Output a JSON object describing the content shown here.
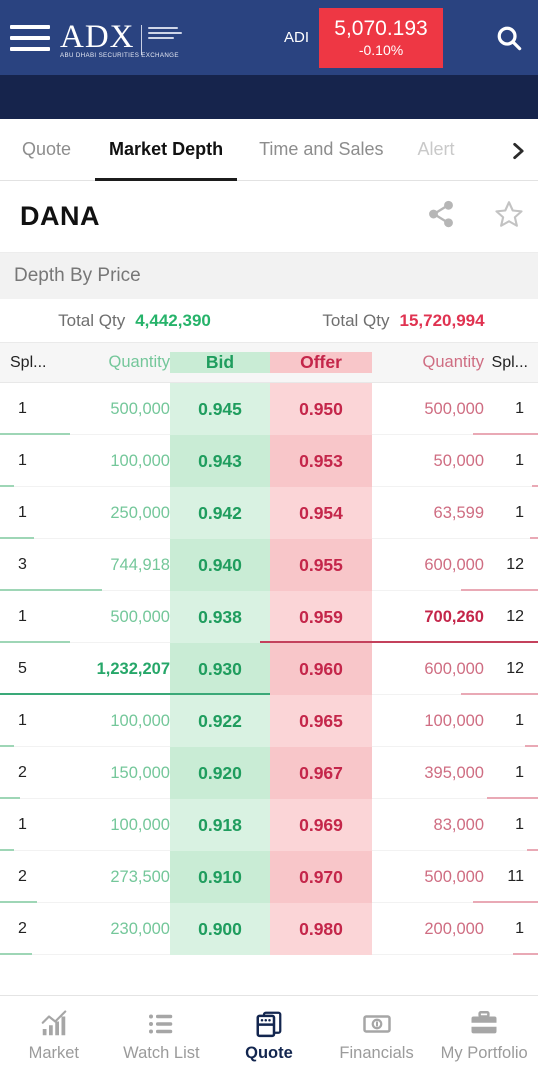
{
  "header": {
    "menu_icon": "hamburger-icon",
    "brand_title": "ADX",
    "brand_subtitle": "ABU DHABI SECURITIES EXCHANGE",
    "index_name": "ADI",
    "index_value": "5,070.193",
    "index_change": "-0.10%",
    "index_color": "#ee3744",
    "search_icon": "search-icon",
    "bg_color": "#2a4380",
    "band_color": "#16244c"
  },
  "tabs": [
    {
      "label": "Quote",
      "active": false
    },
    {
      "label": "Market Depth",
      "active": true
    },
    {
      "label": "Time and Sales",
      "active": false
    },
    {
      "label": "Alert",
      "active": false
    }
  ],
  "tabs_more_icon": "chevron-right-icon",
  "symbol": {
    "name": "DANA",
    "share_icon": "share-icon",
    "favorite_icon": "star-icon"
  },
  "depth": {
    "section_title": "Depth By Price",
    "total_label_bid": "Total Qty",
    "total_value_bid": "4,442,390",
    "total_label_ask": "Total Qty",
    "total_value_ask": "15,720,994",
    "bid_color": "#26b36a",
    "ask_color": "#e03351",
    "columns": [
      "Spl...",
      "Quantity",
      "Bid",
      "Offer",
      "Quantity",
      "Spl..."
    ],
    "rows": [
      {
        "spl_l": "1",
        "qty_l": "500,000",
        "bid": "0.945",
        "ask": "0.950",
        "qty_r": "500,000",
        "spl_r": "1",
        "bar_l": 41,
        "bar_r": 41,
        "hl_l": false,
        "hl_r": false
      },
      {
        "spl_l": "1",
        "qty_l": "100,000",
        "bid": "0.943",
        "ask": "0.953",
        "qty_r": "50,000",
        "spl_r": "1",
        "bar_l": 8,
        "bar_r": 4,
        "hl_l": false,
        "hl_r": false
      },
      {
        "spl_l": "1",
        "qty_l": "250,000",
        "bid": "0.942",
        "ask": "0.954",
        "qty_r": "63,599",
        "spl_r": "1",
        "bar_l": 20,
        "bar_r": 5,
        "hl_l": false,
        "hl_r": false
      },
      {
        "spl_l": "3",
        "qty_l": "744,918",
        "bid": "0.940",
        "ask": "0.955",
        "qty_r": "600,000",
        "spl_r": "12",
        "bar_l": 60,
        "bar_r": 49,
        "hl_l": false,
        "hl_r": false
      },
      {
        "spl_l": "1",
        "qty_l": "500,000",
        "bid": "0.938",
        "ask": "0.959",
        "qty_r": "700,260",
        "spl_r": "12",
        "bar_l": 41,
        "bar_r": 100,
        "hl_l": false,
        "hl_r": true
      },
      {
        "spl_l": "5",
        "qty_l": "1,232,207",
        "bid": "0.930",
        "ask": "0.960",
        "qty_r": "600,000",
        "spl_r": "12",
        "bar_l": 100,
        "bar_r": 49,
        "hl_l": true,
        "hl_r": false
      },
      {
        "spl_l": "1",
        "qty_l": "100,000",
        "bid": "0.922",
        "ask": "0.965",
        "qty_r": "100,000",
        "spl_r": "1",
        "bar_l": 8,
        "bar_r": 8,
        "hl_l": false,
        "hl_r": false
      },
      {
        "spl_l": "2",
        "qty_l": "150,000",
        "bid": "0.920",
        "ask": "0.967",
        "qty_r": "395,000",
        "spl_r": "1",
        "bar_l": 12,
        "bar_r": 32,
        "hl_l": false,
        "hl_r": false
      },
      {
        "spl_l": "1",
        "qty_l": "100,000",
        "bid": "0.918",
        "ask": "0.969",
        "qty_r": "83,000",
        "spl_r": "1",
        "bar_l": 8,
        "bar_r": 7,
        "hl_l": false,
        "hl_r": false
      },
      {
        "spl_l": "2",
        "qty_l": "273,500",
        "bid": "0.910",
        "ask": "0.970",
        "qty_r": "500,000",
        "spl_r": "11",
        "bar_l": 22,
        "bar_r": 41,
        "hl_l": false,
        "hl_r": false
      },
      {
        "spl_l": "2",
        "qty_l": "230,000",
        "bid": "0.900",
        "ask": "0.980",
        "qty_r": "200,000",
        "spl_r": "1",
        "bar_l": 19,
        "bar_r": 16,
        "hl_l": false,
        "hl_r": false
      }
    ]
  },
  "bottom_nav": [
    {
      "label": "Market",
      "icon": "bar-chart-icon",
      "active": false
    },
    {
      "label": "Watch List",
      "icon": "list-icon",
      "active": false
    },
    {
      "label": "Quote",
      "icon": "quote-card-icon",
      "active": true
    },
    {
      "label": "Financials",
      "icon": "banknote-icon",
      "active": false
    },
    {
      "label": "My Portfolio",
      "icon": "briefcase-icon",
      "active": false
    }
  ]
}
